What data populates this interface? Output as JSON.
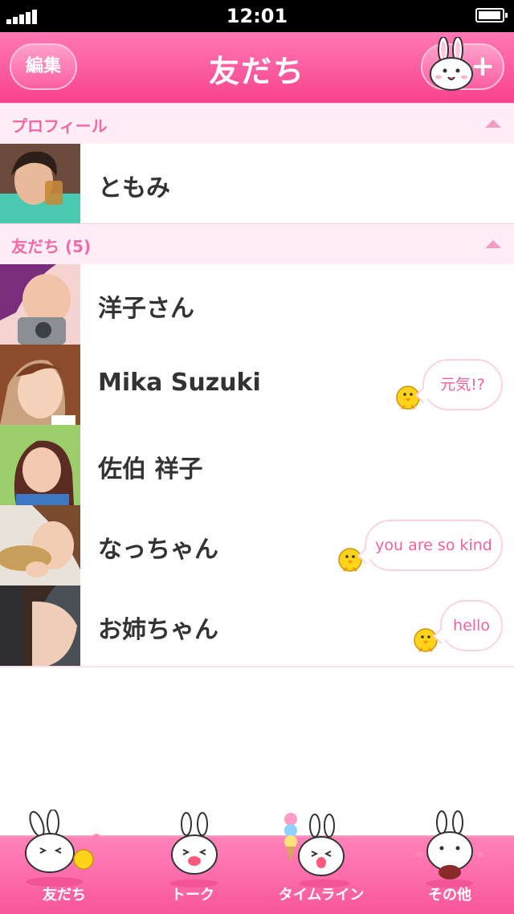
{
  "status_bar": {
    "time": "12:01"
  },
  "nav": {
    "title": "友だち",
    "edit_label": "編集",
    "add_icon": "bunny-add-icon"
  },
  "sections": {
    "profile": {
      "label": "プロフィール"
    },
    "friends": {
      "label": "友だち (5)"
    }
  },
  "profile": {
    "name": "ともみ"
  },
  "friends": [
    {
      "name": "洋子さん",
      "status": ""
    },
    {
      "name": "Mika Suzuki",
      "status": "元気!?"
    },
    {
      "name": "佐伯 祥子",
      "status": ""
    },
    {
      "name": "なっちゃん",
      "status": "you are so kind"
    },
    {
      "name": "お姉ちゃん",
      "status": "hello"
    }
  ],
  "tabs": [
    {
      "label": "友だち",
      "icon": "bunny-chick-icon",
      "active": true
    },
    {
      "label": "トーク",
      "icon": "bunny-laugh-icon"
    },
    {
      "label": "タイムライン",
      "icon": "bunny-icecream-icon"
    },
    {
      "label": "その他",
      "icon": "bunny-other-icon"
    }
  ],
  "colors": {
    "accent": "#f8438f",
    "section_bg": "#ffeef6",
    "section_text": "#f26aa6",
    "bubble_text": "#f0629f"
  }
}
